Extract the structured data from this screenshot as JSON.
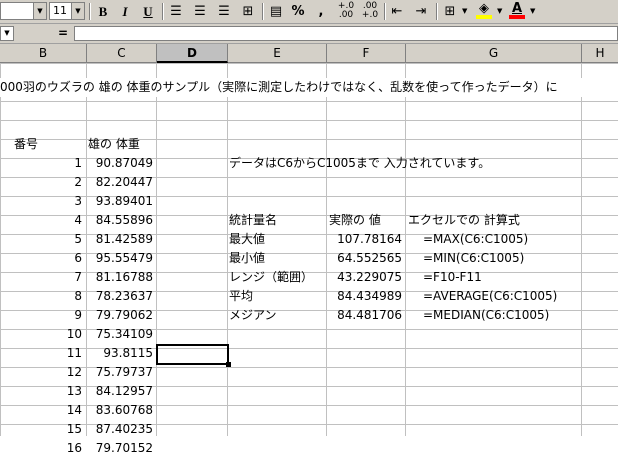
{
  "toolbar": {
    "font_size": "11",
    "bold": "B",
    "italic": "I",
    "underline": "U",
    "percent": "%",
    "comma": ",",
    "inc_decimal": "+.0 .00",
    "dec_decimal": ".00 +.0",
    "fill_color": "#ffff00",
    "font_color": "#ff0000",
    "font_color_glyph": "A"
  },
  "formula_bar": {
    "equals": "=",
    "value": ""
  },
  "columns": [
    "B",
    "C",
    "D",
    "E",
    "F",
    "G",
    "H"
  ],
  "active_column": "D",
  "title_row": "000羽のウズラの 雄の 体重のサンプル（実際に測定したわけではなく、乱数を使って作ったデータ）に",
  "headers": {
    "number": "番号",
    "weight": "雄の 体重"
  },
  "rows": [
    {
      "n": "1",
      "w": "90.87049"
    },
    {
      "n": "2",
      "w": "82.20447"
    },
    {
      "n": "3",
      "w": "93.89401"
    },
    {
      "n": "4",
      "w": "84.55896"
    },
    {
      "n": "5",
      "w": "81.42589"
    },
    {
      "n": "6",
      "w": "95.55479"
    },
    {
      "n": "7",
      "w": "81.16788"
    },
    {
      "n": "8",
      "w": "78.23637"
    },
    {
      "n": "9",
      "w": "79.79062"
    },
    {
      "n": "10",
      "w": "75.34109"
    },
    {
      "n": "11",
      "w": "93.8115"
    },
    {
      "n": "12",
      "w": "75.79737"
    },
    {
      "n": "13",
      "w": "84.12957"
    },
    {
      "n": "14",
      "w": "83.60768"
    },
    {
      "n": "15",
      "w": "87.40235"
    },
    {
      "n": "16",
      "w": "79.70152"
    }
  ],
  "note": "データはC6からC1005まで 入力されています。",
  "stats_header": {
    "name": "統計量名",
    "value": "実際の 値",
    "formula": "エクセルでの 計算式"
  },
  "stats": [
    {
      "name": "最大値",
      "value": "107.78164",
      "formula": "=MAX(C6:C1005)"
    },
    {
      "name": "最小値",
      "value": "64.552565",
      "formula": "=MIN(C6:C1005)"
    },
    {
      "name": "レンジ（範囲）",
      "value": "43.229075",
      "formula": "=F10-F11"
    },
    {
      "name": "平均",
      "value": "84.434989",
      "formula": "=AVERAGE(C6:C1005)"
    },
    {
      "name": "メジアン",
      "value": "84.481706",
      "formula": "=MEDIAN(C6:C1005)"
    }
  ]
}
